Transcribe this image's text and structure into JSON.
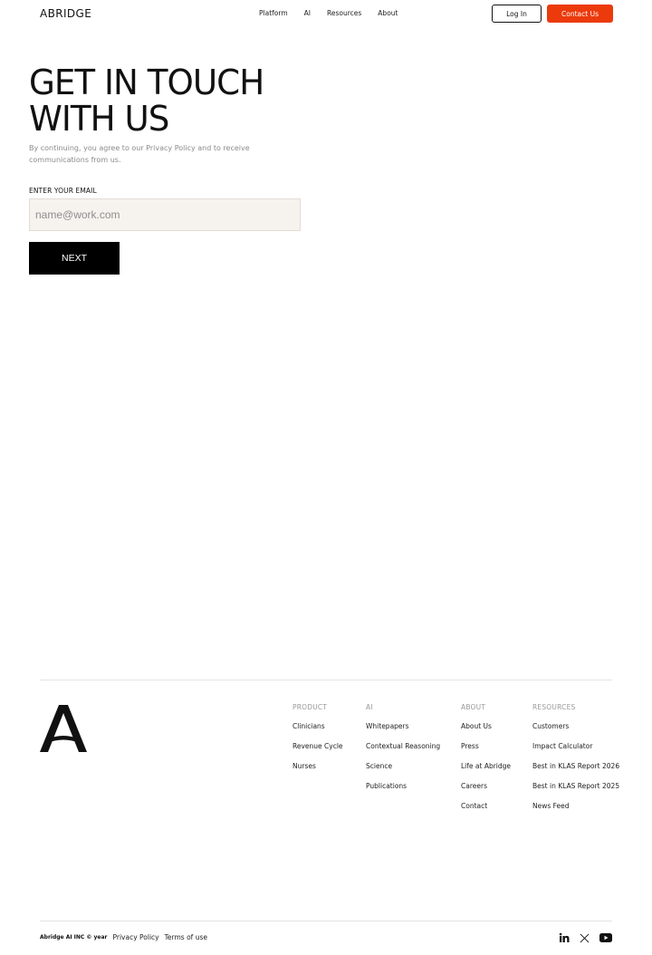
{
  "header": {
    "logo": "ABRIDGE",
    "nav": [
      "Platform",
      "AI",
      "Resources",
      "About"
    ],
    "login_label": "Log In",
    "contact_label": "Contact Us"
  },
  "hero": {
    "title_line1": "GET IN TOUCH",
    "title_line2": "WITH US",
    "consent_text": "By continuing, you agree to our Privacy Policy and to receive communications from us."
  },
  "form": {
    "email_label": "ENTER YOUR EMAIL",
    "email_placeholder": "name@work.com",
    "email_value": "",
    "next_label": "NEXT"
  },
  "footer": {
    "columns": [
      {
        "heading": "PRODUCT",
        "links": [
          "Clinicians",
          "Revenue Cycle",
          "Nurses"
        ]
      },
      {
        "heading": "AI",
        "links": [
          "Whitepapers",
          "Contextual Reasoning",
          "Science",
          "Publications"
        ]
      },
      {
        "heading": "ABOUT",
        "links": [
          "About Us",
          "Press",
          "Life at Abridge",
          "Careers",
          "Contact"
        ]
      },
      {
        "heading": "RESOURCES",
        "links": [
          "Customers",
          "Impact Calculator",
          "Best in KLAS Report 2026",
          "Best in KLAS Report 2025",
          "News Feed"
        ]
      }
    ],
    "copyright": "Abridge AI INC © year",
    "privacy_label": "Privacy Policy",
    "terms_label": "Terms of use",
    "social_icons": [
      "linkedin-icon",
      "x-icon",
      "youtube-icon"
    ]
  },
  "colors": {
    "accent": "#ec3a0c",
    "input_bg": "#f6f2ee",
    "button_dark": "#000000"
  }
}
